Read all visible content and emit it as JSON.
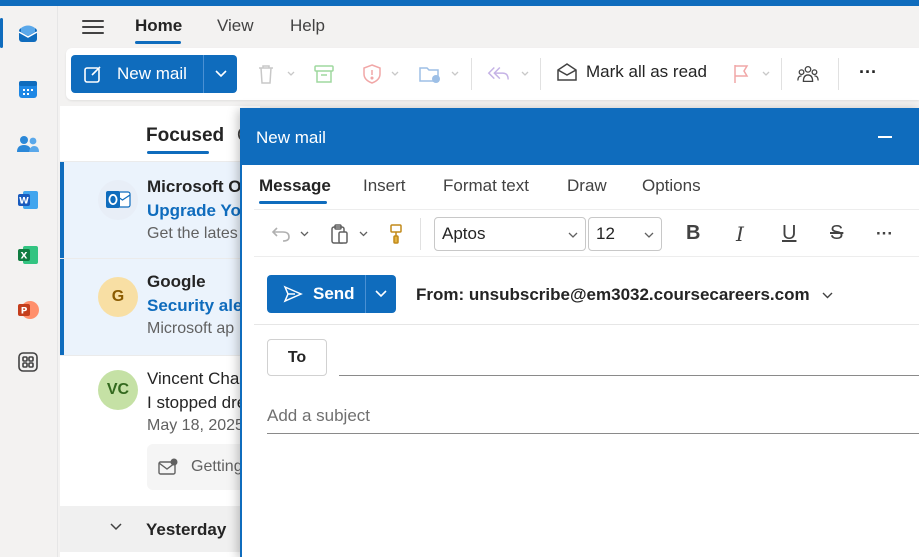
{
  "colors": {
    "brand": "#0f6cbd",
    "surface": "#ffffff",
    "background": "#f3f2f1"
  },
  "app_rail": {
    "icons": [
      "mail-icon",
      "calendar-icon",
      "people-icon",
      "word-icon",
      "excel-icon",
      "powerpoint-icon",
      "apps-icon"
    ]
  },
  "menu": {
    "tabs": [
      "Home",
      "View",
      "Help"
    ],
    "active": "Home"
  },
  "ribbon": {
    "new_mail": "New mail",
    "mark_all_read": "Mark all as read",
    "more": "···"
  },
  "message_list": {
    "tabs": {
      "focused": "Focused",
      "other": "O"
    },
    "messages": [
      {
        "sender": "Microsoft Ou",
        "subject": "Upgrade You",
        "preview": "Get the lates",
        "avatar": "outlook-logo",
        "unread": true,
        "selected": true
      },
      {
        "sender": "Google",
        "subject": "Security aler",
        "preview": "Microsoft ap",
        "avatar": "G",
        "avatar_color": "#f8dfa4",
        "unread": true,
        "selected": false
      },
      {
        "sender": "Vincent Char",
        "subject": "I stopped dre",
        "preview": "May 18, 2025",
        "avatar": "VC",
        "avatar_color": "#c5e1a5",
        "unread": false,
        "selected": false,
        "attachment": "Getting"
      }
    ],
    "group_header": "Yesterday"
  },
  "compose": {
    "title": "New mail",
    "tabs": [
      "Message",
      "Insert",
      "Format text",
      "Draw",
      "Options"
    ],
    "active_tab": "Message",
    "font": "Aptos",
    "font_size": "12",
    "format_buttons": {
      "bold": "B",
      "italic": "I",
      "underline": "U",
      "strike": "S",
      "more": "···"
    },
    "send_label": "Send",
    "from_label": "From: unsubscribe@em3032.coursecareers.com",
    "to_label": "To",
    "subject_placeholder": "Add a subject"
  }
}
